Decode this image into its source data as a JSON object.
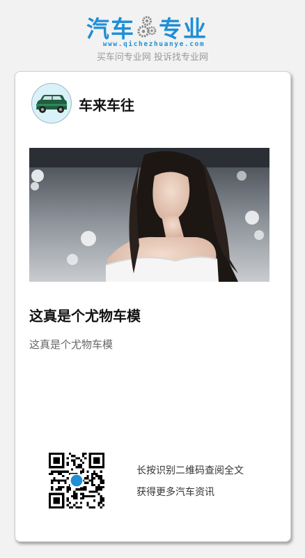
{
  "brand": {
    "name_left": "汽车",
    "name_right": "专业",
    "url": "www.qichezhuanye.com",
    "slogan": "买车问专业网 投诉找专业网",
    "accent": "#1f8fd6"
  },
  "author": {
    "name": "车来车往",
    "avatar_icon": "green-car-icon"
  },
  "article": {
    "image_icon": "car-model-photo",
    "title": "这真是个尤物车模",
    "summary": "这真是个尤物车模"
  },
  "share": {
    "qr_icon": "qr-code-icon",
    "line1": "长按识别二维码查阅全文",
    "line2": "获得更多汽车资讯"
  }
}
